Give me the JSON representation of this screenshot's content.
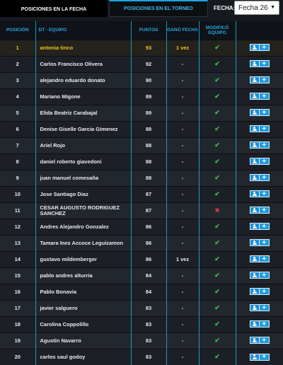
{
  "tabs": [
    {
      "label": "Posiciones en la fecha",
      "active": true
    },
    {
      "label": "Posiciones en el torneo",
      "active": false
    }
  ],
  "fecha": {
    "label": "FECHA:",
    "selected": "Fecha 26"
  },
  "columns": {
    "pos": "Posición",
    "team": "DT - Equipo",
    "pts": "Puntos",
    "won": "Ganó fecha",
    "mod": "Modificó equipo"
  },
  "rows": [
    {
      "pos": "1",
      "team": "antonia tinco",
      "pts": "93",
      "won": "1 vez",
      "mod": "check"
    },
    {
      "pos": "2",
      "team": "Carlos Francisco Olivera",
      "pts": "92",
      "won": "-",
      "mod": "check"
    },
    {
      "pos": "3",
      "team": "alejandro eduardo donato",
      "pts": "90",
      "won": "-",
      "mod": "check"
    },
    {
      "pos": "4",
      "team": "Mariano Migone",
      "pts": "89",
      "won": "-",
      "mod": "check"
    },
    {
      "pos": "5",
      "team": "Elida Beatriz Carabajal",
      "pts": "89",
      "won": "-",
      "mod": "check"
    },
    {
      "pos": "6",
      "team": "Denise Giselle Garcia Gimenez",
      "pts": "88",
      "won": "-",
      "mod": "check"
    },
    {
      "pos": "7",
      "team": "Ariel Rojo",
      "pts": "88",
      "won": "-",
      "mod": "check"
    },
    {
      "pos": "8",
      "team": "daniel roberto giavedoni",
      "pts": "88",
      "won": "-",
      "mod": "check"
    },
    {
      "pos": "9",
      "team": "juan manuel comesaña",
      "pts": "88",
      "won": "-",
      "mod": "check"
    },
    {
      "pos": "10",
      "team": "Jose Santiago Diaz",
      "pts": "87",
      "won": "-",
      "mod": "check"
    },
    {
      "pos": "11",
      "team": "CESAR AUGUSTO RODRIGUEZ SANCHEZ",
      "pts": "87",
      "won": "-",
      "mod": "cross"
    },
    {
      "pos": "12",
      "team": "Andres Alejandro Gonzalez",
      "pts": "86",
      "won": "-",
      "mod": "check"
    },
    {
      "pos": "13",
      "team": "Tamara Ines Accoce Leguizamon",
      "pts": "86",
      "won": "-",
      "mod": "check"
    },
    {
      "pos": "14",
      "team": "gustavo mildemberger",
      "pts": "86",
      "won": "1 vez",
      "mod": "check"
    },
    {
      "pos": "15",
      "team": "pablo andres alturria",
      "pts": "84",
      "won": "-",
      "mod": "check"
    },
    {
      "pos": "16",
      "team": "Pablo Bonavia",
      "pts": "84",
      "won": "-",
      "mod": "check"
    },
    {
      "pos": "17",
      "team": "javier salguero",
      "pts": "83",
      "won": "-",
      "mod": "check"
    },
    {
      "pos": "18",
      "team": "Carolina Coppolillo",
      "pts": "83",
      "won": "-",
      "mod": "check"
    },
    {
      "pos": "19",
      "team": "Agustin Navarro",
      "pts": "83",
      "won": "-",
      "mod": "check"
    },
    {
      "pos": "20",
      "team": "carlos saul godoy",
      "pts": "83",
      "won": "-",
      "mod": "check"
    }
  ],
  "icons": {
    "check": "check-icon",
    "cross": "cross-icon",
    "user": "user-icon",
    "plus": "plus-icon"
  },
  "colors": {
    "accent": "#24a9e6",
    "highlight": "#f3c21f",
    "check": "#37c24a",
    "cross": "#d83a3a"
  }
}
